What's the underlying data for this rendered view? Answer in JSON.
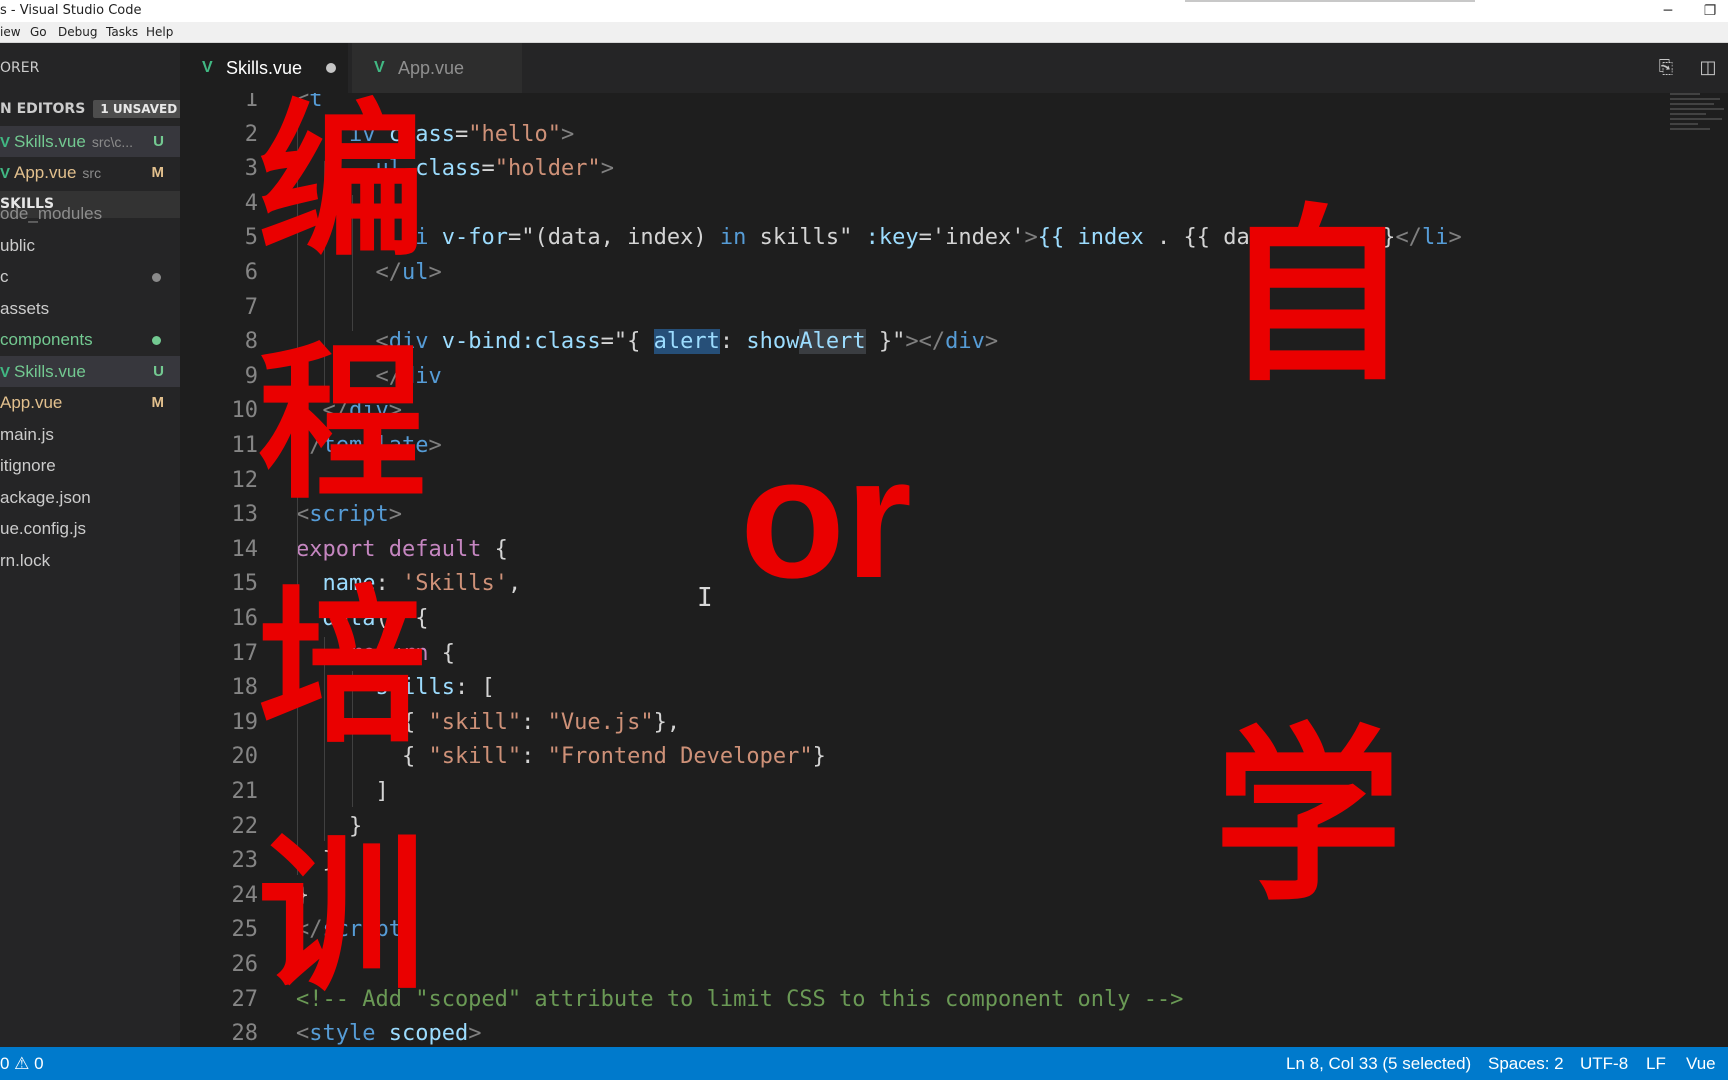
{
  "window": {
    "title": "s - Visual Studio Code",
    "minimize_glyph": "─",
    "restore_glyph": "❐"
  },
  "menubar": [
    "iew",
    "Go",
    "Debug",
    "Tasks",
    "Help"
  ],
  "sidebar": {
    "explorer_title": "ORER",
    "open_editors": {
      "title": "N EDITORS",
      "badge": "1 UNSAVED",
      "items": [
        {
          "name": "Skills.vue",
          "path": "src\\c...",
          "status": "U",
          "color": "#73c991"
        },
        {
          "name": "App.vue",
          "path": "src",
          "status": "M",
          "color": "#e2c08d"
        }
      ]
    },
    "project": {
      "title": "SKILLS",
      "items": [
        {
          "name": "ode_modules",
          "color": "#8c8c8c",
          "status": ""
        },
        {
          "name": "ublic",
          "color": "#cccccc",
          "status": ""
        },
        {
          "name": "c",
          "color": "#cccccc",
          "status": "dot",
          "dot_color": "#8a8a8a"
        },
        {
          "name": "assets",
          "color": "#cccccc",
          "status": ""
        },
        {
          "name": "components",
          "color": "#73c991",
          "status": "dot",
          "dot_color": "#73c991"
        },
        {
          "name": "Skills.vue",
          "color": "#73c991",
          "status": "U",
          "vue": true,
          "selected": true
        },
        {
          "name": "App.vue",
          "color": "#e2c08d",
          "status": "M"
        },
        {
          "name": "main.js",
          "color": "#cccccc",
          "status": ""
        },
        {
          "name": "itignore",
          "color": "#cccccc",
          "status": ""
        },
        {
          "name": "ackage.json",
          "color": "#cccccc",
          "status": ""
        },
        {
          "name": "ue.config.js",
          "color": "#cccccc",
          "status": ""
        },
        {
          "name": "rn.lock",
          "color": "#cccccc",
          "status": ""
        }
      ]
    }
  },
  "tabs": [
    {
      "label": "Skills.vue",
      "active": true,
      "unsaved": true
    },
    {
      "label": "App.vue",
      "active": false,
      "unsaved": false
    }
  ],
  "editor": {
    "line_numbers": [
      "1",
      "2",
      "3",
      "4",
      "5",
      "6",
      "7",
      "8",
      "9",
      "10",
      "11",
      "12",
      "13",
      "14",
      "15",
      "16",
      "17",
      "18",
      "19",
      "20",
      "21",
      "22",
      "23",
      "24",
      "25",
      "26",
      "27",
      "28"
    ],
    "lines": [
      [
        {
          "t": "<",
          "c": "br"
        },
        {
          "t": "t",
          "c": "tag"
        }
      ],
      [
        {
          "t": "    ",
          "c": "plain"
        },
        {
          "t": "iv ",
          "c": "tag"
        },
        {
          "t": "class",
          "c": "attr"
        },
        {
          "t": "=",
          "c": "plain"
        },
        {
          "t": "\"hello\"",
          "c": "str"
        },
        {
          "t": ">",
          "c": "br"
        }
      ],
      [
        {
          "t": "      ",
          "c": "plain"
        },
        {
          "t": "ul ",
          "c": "tag"
        },
        {
          "t": "class",
          "c": "attr"
        },
        {
          "t": "=",
          "c": "plain"
        },
        {
          "t": "\"holder\"",
          "c": "str"
        },
        {
          "t": ">",
          "c": "br"
        }
      ],
      [],
      [
        {
          "t": "        ",
          "c": "plain"
        },
        {
          "t": "li ",
          "c": "tag"
        },
        {
          "t": "v-for",
          "c": "attr"
        },
        {
          "t": "=\"(data, index) ",
          "c": "plain"
        },
        {
          "t": "in",
          "c": "tag"
        },
        {
          "t": " skills\" ",
          "c": "plain"
        },
        {
          "t": ":key",
          "c": "attr"
        },
        {
          "t": "=",
          "c": "plain"
        },
        {
          "t": "'index'",
          "c": "plain"
        },
        {
          "t": ">",
          "c": "br"
        },
        {
          "t": "{{ index ",
          "c": "attr"
        },
        {
          "t": ". {{ data.skill }}",
          "c": "plain"
        },
        {
          "t": "</",
          "c": "br"
        },
        {
          "t": "li",
          "c": "tag"
        },
        {
          "t": ">",
          "c": "br"
        }
      ],
      [
        {
          "t": "      ",
          "c": "plain"
        },
        {
          "t": "</",
          "c": "br"
        },
        {
          "t": "ul",
          "c": "tag"
        },
        {
          "t": ">",
          "c": "br"
        }
      ],
      [],
      [
        {
          "t": "      ",
          "c": "plain"
        },
        {
          "t": "<",
          "c": "br"
        },
        {
          "t": "div ",
          "c": "tag"
        },
        {
          "t": "v-bind:class",
          "c": "attr"
        },
        {
          "t": "=\"{ ",
          "c": "plain"
        },
        {
          "t": "alert",
          "c": "attr",
          "sel": true
        },
        {
          "t": ": ",
          "c": "plain"
        },
        {
          "t": "show",
          "c": "attr"
        },
        {
          "t": "Alert",
          "c": "attr",
          "hl": true
        },
        {
          "t": " }\"",
          "c": "plain"
        },
        {
          "t": "></",
          "c": "br"
        },
        {
          "t": "div",
          "c": "tag"
        },
        {
          "t": ">",
          "c": "br"
        }
      ],
      [
        {
          "t": "      ",
          "c": "plain"
        },
        {
          "t": "</",
          "c": "br"
        },
        {
          "t": "div",
          "c": "tag"
        }
      ],
      [
        {
          "t": "  ",
          "c": "plain"
        },
        {
          "t": "</",
          "c": "br"
        },
        {
          "t": "div",
          "c": "tag"
        },
        {
          "t": ">",
          "c": "br"
        }
      ],
      [
        {
          "t": "</",
          "c": "br"
        },
        {
          "t": "template",
          "c": "tag"
        },
        {
          "t": ">",
          "c": "br"
        }
      ],
      [],
      [
        {
          "t": "<",
          "c": "br"
        },
        {
          "t": "script",
          "c": "tag"
        },
        {
          "t": ">",
          "c": "br"
        }
      ],
      [
        {
          "t": "export default",
          "c": "kw"
        },
        {
          "t": " {",
          "c": "plain"
        }
      ],
      [
        {
          "t": "  name",
          "c": "attr"
        },
        {
          "t": ": ",
          "c": "plain"
        },
        {
          "t": "'Skills'",
          "c": "str"
        },
        {
          "t": ",",
          "c": "plain"
        }
      ],
      [
        {
          "t": "  data",
          "c": "attr"
        },
        {
          "t": "() {",
          "c": "plain"
        }
      ],
      [
        {
          "t": "    ",
          "c": "plain"
        },
        {
          "t": "return",
          "c": "kw"
        },
        {
          "t": " {",
          "c": "plain"
        }
      ],
      [
        {
          "t": "      ",
          "c": "plain"
        },
        {
          "t": "skills",
          "c": "attr"
        },
        {
          "t": ": [",
          "c": "plain"
        }
      ],
      [
        {
          "t": "        { ",
          "c": "plain"
        },
        {
          "t": "\"skill\"",
          "c": "str"
        },
        {
          "t": ": ",
          "c": "plain"
        },
        {
          "t": "\"Vue.js\"",
          "c": "str"
        },
        {
          "t": "},",
          "c": "plain"
        }
      ],
      [
        {
          "t": "        { ",
          "c": "plain"
        },
        {
          "t": "\"skill\"",
          "c": "str"
        },
        {
          "t": ": ",
          "c": "plain"
        },
        {
          "t": "\"Frontend Developer\"",
          "c": "str"
        },
        {
          "t": "}",
          "c": "plain"
        }
      ],
      [
        {
          "t": "      ]",
          "c": "plain"
        }
      ],
      [
        {
          "t": "    }",
          "c": "plain"
        }
      ],
      [
        {
          "t": "  }",
          "c": "plain"
        }
      ],
      [
        {
          "t": "}",
          "c": "plain"
        }
      ],
      [
        {
          "t": "</",
          "c": "br"
        },
        {
          "t": "script",
          "c": "tag"
        },
        {
          "t": ">",
          "c": "br"
        }
      ],
      [],
      [
        {
          "t": "<!-- Add \"scoped\" attribute to limit CSS to this component only -->",
          "c": "com"
        }
      ],
      [
        {
          "t": "<",
          "c": "br"
        },
        {
          "t": "style ",
          "c": "tag"
        },
        {
          "t": "scoped",
          "c": "attr"
        },
        {
          "t": ">",
          "c": "br"
        }
      ]
    ]
  },
  "overlay": {
    "left_column": [
      "编",
      "程",
      "培",
      "训"
    ],
    "right_top": "自",
    "right_bottom": "学",
    "middle": "or"
  },
  "statusbar": {
    "problems": "0 ⚠ 0",
    "position": "Ln 8, Col 33 (5 selected)",
    "spaces": "Spaces: 2",
    "encoding": "UTF-8",
    "eol": "LF",
    "language": "Vue"
  },
  "colors": {
    "accent": "#007acc",
    "overlay_red": "#ea0000",
    "vue_green": "#41b883"
  }
}
